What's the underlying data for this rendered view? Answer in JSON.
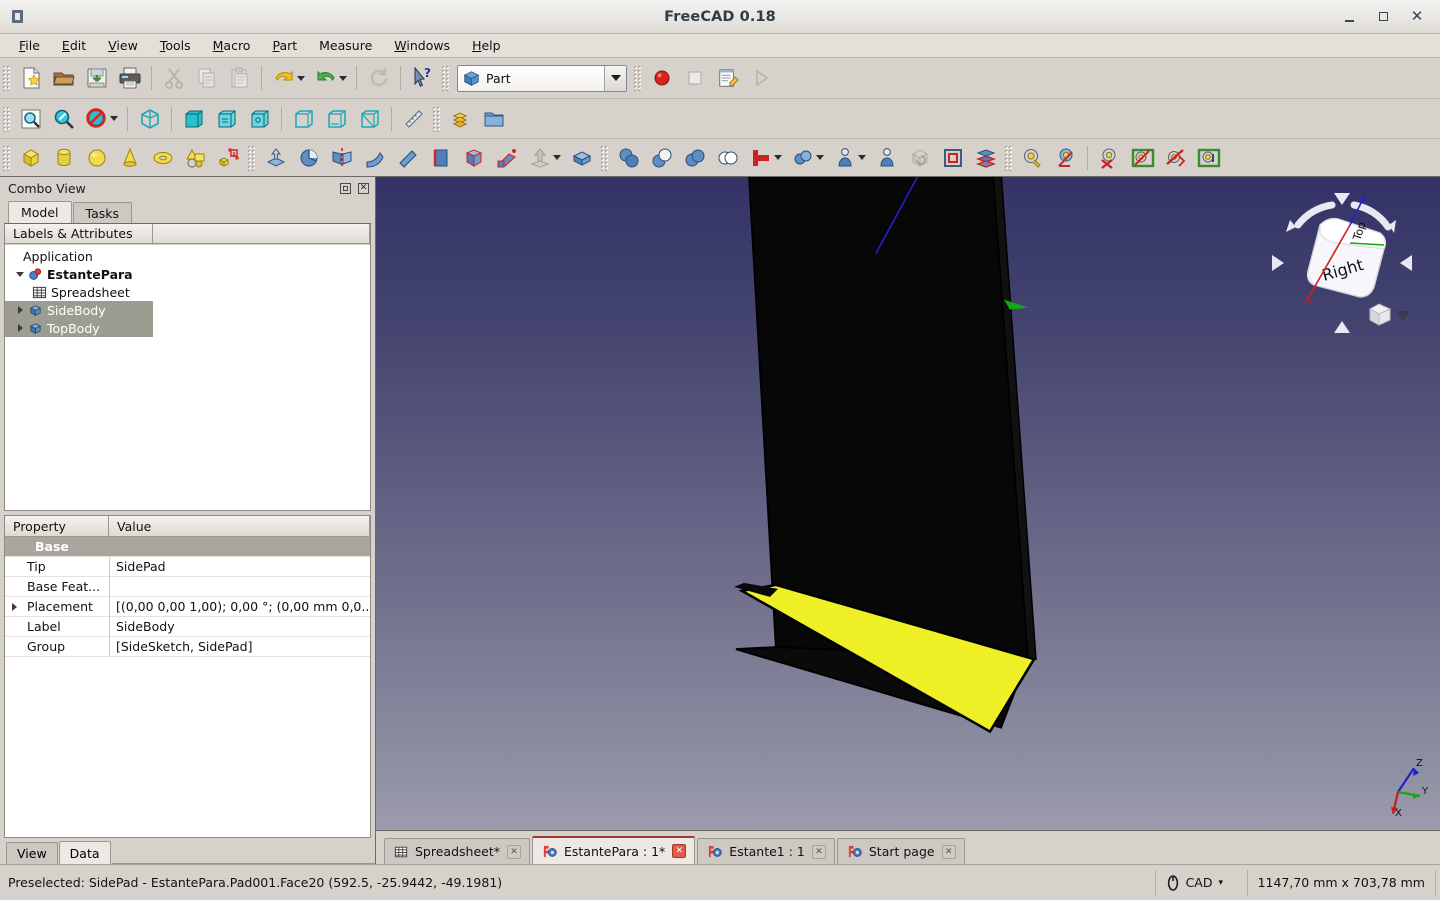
{
  "window": {
    "title": "FreeCAD 0.18",
    "app_icon": "freecad-icon",
    "minimize": "–",
    "maximize": "□",
    "close": "✕"
  },
  "menubar": {
    "items": [
      {
        "label": "File",
        "mnemonic": "F"
      },
      {
        "label": "Edit",
        "mnemonic": "E"
      },
      {
        "label": "View",
        "mnemonic": "V"
      },
      {
        "label": "Tools",
        "mnemonic": "T"
      },
      {
        "label": "Macro",
        "mnemonic": "M"
      },
      {
        "label": "Part",
        "mnemonic": "P"
      },
      {
        "label": "Measure",
        "mnemonic": ""
      },
      {
        "label": "Windows",
        "mnemonic": "W"
      },
      {
        "label": "Help",
        "mnemonic": "H"
      }
    ]
  },
  "toolbars": {
    "file": [
      {
        "name": "new-document-icon",
        "title": "New"
      },
      {
        "name": "open-document-icon",
        "title": "Open"
      },
      {
        "name": "save-document-icon",
        "title": "Save"
      },
      {
        "name": "print-icon",
        "title": "Print"
      },
      {
        "name": "cut-icon",
        "title": "Cut"
      },
      {
        "name": "copy-icon",
        "title": "Copy"
      },
      {
        "name": "paste-icon",
        "title": "Paste"
      },
      {
        "name": "undo-icon",
        "title": "Undo"
      },
      {
        "name": "redo-icon",
        "title": "Redo"
      },
      {
        "name": "refresh-icon",
        "title": "Refresh"
      },
      {
        "name": "whats-this-icon",
        "title": "What's This"
      }
    ],
    "workbench": {
      "selected": "Part",
      "icon": "part-workbench-icon"
    },
    "macro": [
      {
        "name": "macro-record-icon",
        "title": "Macro recording"
      },
      {
        "name": "macro-stop-icon",
        "title": "Stop macro recording"
      },
      {
        "name": "macro-edit-icon",
        "title": "Macros"
      },
      {
        "name": "macro-execute-icon",
        "title": "Execute macro"
      }
    ],
    "view": [
      {
        "name": "fit-all-icon",
        "title": "Fit all"
      },
      {
        "name": "fit-selection-icon",
        "title": "Fit selection"
      },
      {
        "name": "draw-style-icon",
        "title": "Draw style"
      },
      {
        "name": "isometric-view-icon",
        "title": "Isometric"
      },
      {
        "name": "front-view-icon",
        "title": "Front"
      },
      {
        "name": "top-view-icon",
        "title": "Top"
      },
      {
        "name": "right-view-icon",
        "title": "Right"
      },
      {
        "name": "rear-view-icon",
        "title": "Rear"
      },
      {
        "name": "bottom-view-icon",
        "title": "Bottom"
      },
      {
        "name": "left-view-icon",
        "title": "Left"
      },
      {
        "name": "measure-ruler-icon",
        "title": "Measure"
      },
      {
        "name": "workbench-structure-icon",
        "title": "Create part"
      },
      {
        "name": "create-group-icon",
        "title": "Create group"
      }
    ],
    "primitives": [
      {
        "name": "box-primitive-icon",
        "title": "Cube"
      },
      {
        "name": "cylinder-primitive-icon",
        "title": "Cylinder"
      },
      {
        "name": "sphere-primitive-icon",
        "title": "Sphere"
      },
      {
        "name": "cone-primitive-icon",
        "title": "Cone"
      },
      {
        "name": "torus-primitive-icon",
        "title": "Torus"
      },
      {
        "name": "shape-builder-icon",
        "title": "Shape builder"
      },
      {
        "name": "primitives-dialog-icon",
        "title": "Create primitives"
      }
    ],
    "modeling": [
      {
        "name": "extrude-icon",
        "title": "Extrude"
      },
      {
        "name": "revolve-icon",
        "title": "Revolve"
      },
      {
        "name": "mirror-icon",
        "title": "Mirroring"
      },
      {
        "name": "fillet-icon",
        "title": "Fillet"
      },
      {
        "name": "chamfer-icon",
        "title": "Chamfer"
      },
      {
        "name": "ruled-surface-icon",
        "title": "Ruled surface"
      },
      {
        "name": "loft-icon",
        "title": "Loft"
      },
      {
        "name": "sweep-icon",
        "title": "Sweep"
      },
      {
        "name": "offset-icon",
        "title": "3D offset"
      },
      {
        "name": "thickness-icon",
        "title": "Thickness"
      }
    ],
    "boolean": [
      {
        "name": "compound-icon",
        "title": "Compound"
      },
      {
        "name": "boolean-icon",
        "title": "Boolean"
      },
      {
        "name": "union-icon",
        "title": "Union"
      },
      {
        "name": "intersection-icon",
        "title": "Intersection"
      },
      {
        "name": "boolean-cut-icon",
        "title": "Cut"
      },
      {
        "name": "join-connect-icon",
        "title": "Join objects"
      },
      {
        "name": "split-icon",
        "title": "Split"
      },
      {
        "name": "attachment-icon",
        "title": "Attachment"
      },
      {
        "name": "convert-to-shape-icon",
        "title": "Convert to shape"
      },
      {
        "name": "cross-sections-icon",
        "title": "Cross-sections"
      }
    ],
    "measure": [
      {
        "name": "measure-linear-icon",
        "title": "Measure linear"
      },
      {
        "name": "measure-angular-icon",
        "title": "Measure angular"
      },
      {
        "name": "measure-clear-all-icon",
        "title": "Clear all"
      },
      {
        "name": "measure-toggle-all-icon",
        "title": "Toggle all"
      },
      {
        "name": "measure-toggle-3d-icon",
        "title": "Toggle 3D"
      },
      {
        "name": "measure-toggle-delta-icon",
        "title": "Toggle delta"
      }
    ]
  },
  "combo_view": {
    "title": "Combo View",
    "undock_icon": "undock-icon",
    "close_icon": "close-icon",
    "tabs": [
      {
        "label": "Model",
        "active": true
      },
      {
        "label": "Tasks",
        "active": false
      }
    ],
    "tree": {
      "header": {
        "col1": "Labels & Attributes",
        "col2": ""
      },
      "rows": [
        {
          "label": "Application",
          "depth": 0,
          "icon": "",
          "twist": "",
          "bold": false,
          "selected": false
        },
        {
          "label": "EstantePara",
          "depth": 1,
          "icon": "document-icon",
          "twist": "down",
          "bold": true,
          "selected": false
        },
        {
          "label": "Spreadsheet",
          "depth": 2,
          "icon": "spreadsheet-icon",
          "twist": "",
          "bold": false,
          "selected": false
        },
        {
          "label": "SideBody",
          "depth": 1,
          "icon": "body-icon",
          "twist": "right",
          "bold": false,
          "selected": true
        },
        {
          "label": "TopBody",
          "depth": 1,
          "icon": "body-icon",
          "twist": "right",
          "bold": false,
          "selected": true
        }
      ]
    },
    "properties": {
      "header": {
        "col1": "Property",
        "col2": "Value"
      },
      "rows": [
        {
          "group": true,
          "name": "Base",
          "value": "",
          "expandable": false
        },
        {
          "group": false,
          "name": "Tip",
          "value": "SidePad",
          "expandable": false
        },
        {
          "group": false,
          "name": "Base Feat...",
          "value": "",
          "expandable": false
        },
        {
          "group": false,
          "name": "Placement",
          "value": "[(0,00 0,00 1,00); 0,00 °; (0,00 mm  0,0...",
          "expandable": true
        },
        {
          "group": false,
          "name": "Label",
          "value": "SideBody",
          "expandable": false
        },
        {
          "group": false,
          "name": "Group",
          "value": "[SideSketch, SidePad]",
          "expandable": false
        }
      ]
    },
    "bottom_tabs": [
      {
        "label": "View",
        "active": false
      },
      {
        "label": "Data",
        "active": true
      }
    ]
  },
  "view3d": {
    "background_top": "#333366",
    "background_bottom": "#9b9bac",
    "navigation_cube": {
      "face_front": "Right",
      "face_top": "Top",
      "axis_z": "Z",
      "axis_x": "X",
      "arrow_up": "rotate-up-arrow",
      "arrow_down": "rotate-down-arrow",
      "arrow_left": "rotate-left-arrow",
      "arrow_right": "rotate-right-arrow"
    },
    "axis_indicator": {
      "z": "Z",
      "y": "Y",
      "x": "X"
    },
    "model": {
      "body_color": "#050505",
      "highlight_face_color": "#efef26",
      "edge_color": "#000000"
    }
  },
  "document_tabs": [
    {
      "label": "Spreadsheet*",
      "icon": "spreadsheet-icon",
      "active": false,
      "close": "✕"
    },
    {
      "label": "EstantePara : 1*",
      "icon": "freecad-doc-icon",
      "active": true,
      "close": "✕"
    },
    {
      "label": "Estante1 : 1",
      "icon": "freecad-doc-icon",
      "active": false,
      "close": "✕"
    },
    {
      "label": "Start page",
      "icon": "freecad-doc-icon",
      "active": false,
      "close": "✕"
    }
  ],
  "statusbar": {
    "message": "Preselected: SidePad - EstantePara.Pad001.Face20 (592.5, -25.9442, -49.1981)",
    "unit_icon": "unit-system-icon",
    "unit_label": "CAD",
    "unit_caret": "▾",
    "dimensions": "1147,70 mm x 703,78 mm"
  }
}
